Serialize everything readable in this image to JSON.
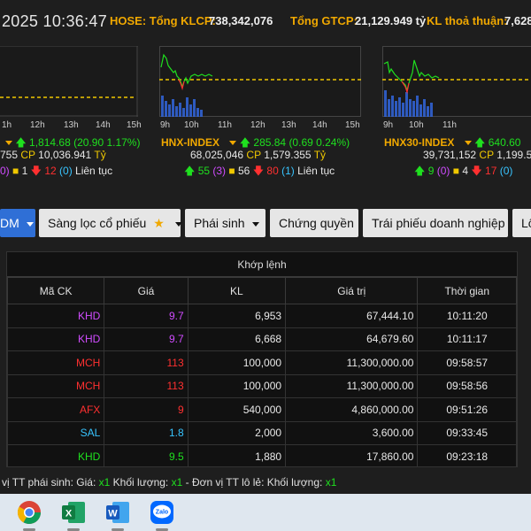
{
  "header": {
    "time": "2025 10:36:47",
    "hose_label": "HOSE: Tổng KLCP:",
    "hose_value": "738,342,076",
    "gtcp_label": "Tổng GTCP:",
    "gtcp_value": "21,129.949 tỷ",
    "kl_label": "KL thoả thuận:",
    "kl_value": "7,628"
  },
  "charts": [
    {
      "ticks": [
        "1h",
        "12h",
        "13h",
        "14h",
        "15h"
      ],
      "summary_line1": {
        "name": "",
        "value": "1,814.68",
        "change": "(20.90 1.17%)"
      },
      "summary_line2": {
        "volume": "755",
        "cp_label": "CP",
        "value": "10,036.941",
        "unit": "Tỷ"
      },
      "summary_line3": {
        "up": "",
        "ceil": "0)",
        "ref": "1",
        "down": "12",
        "floor": "(0)",
        "status": "Liên tục"
      }
    },
    {
      "ticks": [
        "9h",
        "10h",
        "11h",
        "12h",
        "13h",
        "14h",
        "15h"
      ],
      "summary_line1": {
        "name": "HNX-INDEX",
        "value": "285.84",
        "change": "(0.69 0.24%)"
      },
      "summary_line2": {
        "volume": "68,025,046",
        "cp_label": "CP",
        "value": "1,579.355",
        "unit": "Tỷ"
      },
      "summary_line3": {
        "up": "55",
        "ceil": "(3)",
        "ref": "56",
        "down": "80",
        "floor": "(1)",
        "status": "Liên tục"
      }
    },
    {
      "ticks": [
        "9h",
        "10h",
        "11h"
      ],
      "summary_line1": {
        "name": "HNX30-INDEX",
        "value": "640.60",
        "change": ""
      },
      "summary_line2": {
        "volume": "39,731,152",
        "cp_label": "CP",
        "value": "1,199.54",
        "unit": ""
      },
      "summary_line3": {
        "up": "9",
        "ceil": "(0)",
        "ref": "4",
        "down": "17",
        "floor": "(0)",
        "status": ""
      }
    }
  ],
  "tabs": {
    "first": "DM",
    "filter": "Sàng lọc cổ phiếu",
    "derivatives": "Phái sinh",
    "warrants": "Chứng quyền",
    "bonds": "Trái phiếu doanh nghiệp",
    "odd": "Lô"
  },
  "table": {
    "caption": "Khớp lệnh",
    "headers": [
      "Mã CK",
      "Giá",
      "KL",
      "Giá trị",
      "Thời gian"
    ],
    "rows": [
      {
        "symbol": "KHD",
        "price": "9.7",
        "volume": "6,953",
        "value": "67,444.10",
        "time": "10:11:20",
        "color": "#d04cff"
      },
      {
        "symbol": "KHD",
        "price": "9.7",
        "volume": "6,668",
        "value": "64,679.60",
        "time": "10:11:17",
        "color": "#d04cff"
      },
      {
        "symbol": "MCH",
        "price": "113",
        "volume": "100,000",
        "value": "11,300,000.00",
        "time": "09:58:57",
        "color": "#ff3030"
      },
      {
        "symbol": "MCH",
        "price": "113",
        "volume": "100,000",
        "value": "11,300,000.00",
        "time": "09:58:56",
        "color": "#ff3030"
      },
      {
        "symbol": "AFX",
        "price": "9",
        "volume": "540,000",
        "value": "4,860,000.00",
        "time": "09:51:26",
        "color": "#ff3030"
      },
      {
        "symbol": "SAL",
        "price": "1.8",
        "volume": "2,000",
        "value": "3,600.00",
        "time": "09:33:45",
        "color": "#38c4ff"
      },
      {
        "symbol": "KHD",
        "price": "9.5",
        "volume": "1,880",
        "value": "17,860.00",
        "time": "09:23:18",
        "color": "#1fe01f"
      }
    ]
  },
  "footer": {
    "prefix": "vị TT phái sinh: Giá:",
    "x1": "x1",
    "kl_label": "Khối lượng:",
    "x2": "x1",
    "mid": "- Đơn vị TT lô lẻ: Khối lượng:",
    "x3": "x1"
  },
  "taskbar": {
    "icons": [
      "chrome-icon",
      "excel-icon",
      "word-icon",
      "zalo-icon"
    ],
    "zalo_text": "Zalo"
  }
}
